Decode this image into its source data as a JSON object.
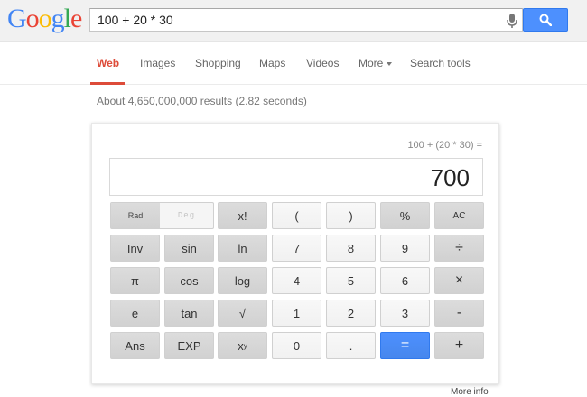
{
  "header": {
    "logo_letters": [
      {
        "ch": "G",
        "color": "#4285f4"
      },
      {
        "ch": "o",
        "color": "#ea4335"
      },
      {
        "ch": "o",
        "color": "#fbbc05"
      },
      {
        "ch": "g",
        "color": "#4285f4"
      },
      {
        "ch": "l",
        "color": "#34a853"
      },
      {
        "ch": "e",
        "color": "#ea4335"
      }
    ],
    "search_value": "100 + 20 * 30",
    "mic_icon": "microphone-icon",
    "search_button_icon": "magnifier-icon"
  },
  "tabs": {
    "web": "Web",
    "images": "Images",
    "shopping": "Shopping",
    "maps": "Maps",
    "videos": "Videos",
    "more": "More",
    "search_tools": "Search tools"
  },
  "stats": "About 4,650,000,000 results (2.82 seconds)",
  "calculator": {
    "expression": "100 + (20 * 30) =",
    "result": "700",
    "rad_label": "Rad",
    "deg_label": "Deg",
    "keys": {
      "r1": [
        "x!",
        "(",
        ")",
        "%",
        "AC"
      ],
      "r2": [
        "Inv",
        "sin",
        "ln",
        "7",
        "8",
        "9",
        "÷"
      ],
      "r3": [
        "π",
        "cos",
        "log",
        "4",
        "5",
        "6",
        "×"
      ],
      "r4": [
        "e",
        "tan",
        "√",
        "1",
        "2",
        "3",
        "-"
      ],
      "r5": [
        "Ans",
        "EXP",
        "0",
        ".",
        "=",
        "+"
      ],
      "pow_base": "x",
      "pow_exp": "y"
    }
  },
  "more_info": "More info"
}
